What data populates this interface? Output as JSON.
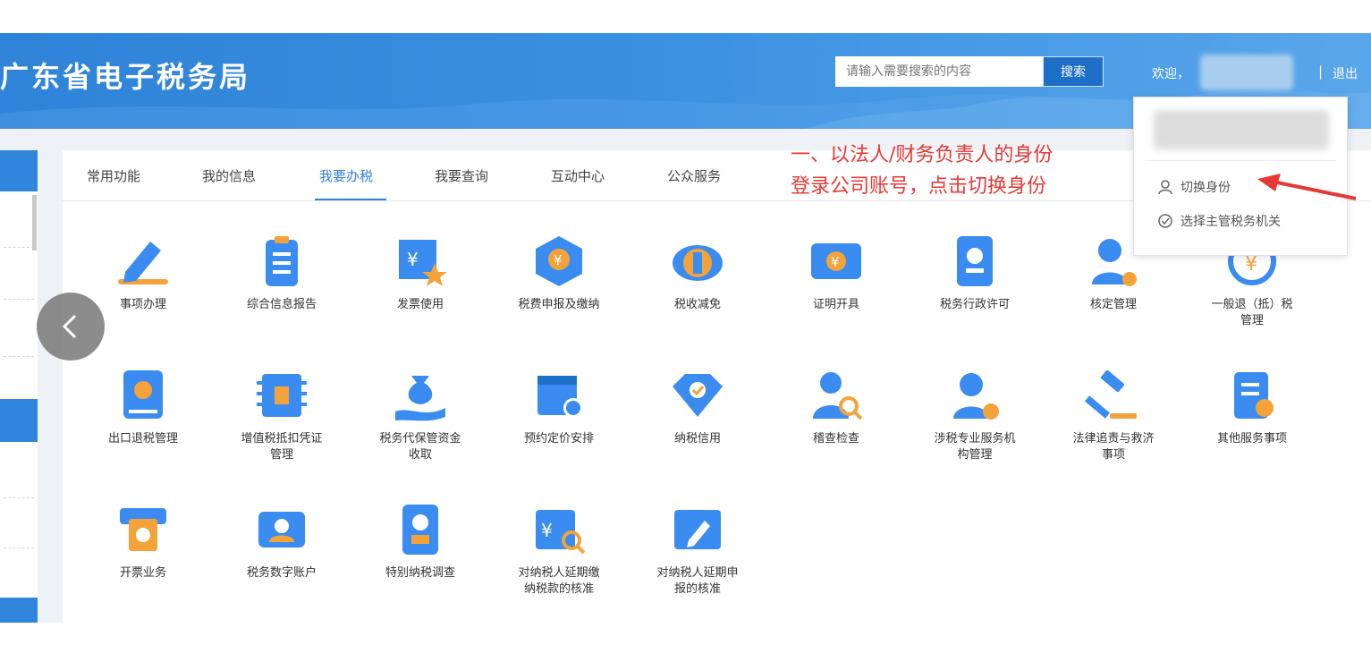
{
  "header": {
    "title": "广东省电子税务局",
    "search_placeholder": "请输入需要搜索的内容",
    "search_button": "搜索",
    "welcome": "欢迎，",
    "separator": "|",
    "logout": "退出"
  },
  "tabs": [
    "常用功能",
    "我的信息",
    "我要办税",
    "我要查询",
    "互动中心",
    "公众服务"
  ],
  "active_tab": "我要办税",
  "annotation": {
    "line1": "一、以法人/财务负责人的身份",
    "line2": "登录公司账号，点击切换身份"
  },
  "dropdown": {
    "items": [
      "切换身份",
      "选择主管税务机关"
    ]
  },
  "services": [
    [
      "事项办理",
      "综合信息报告",
      "发票使用",
      "税费申报及缴纳",
      "税收减免",
      "证明开具",
      "税务行政许可",
      "核定管理",
      "一般退（抵）税\n管理"
    ],
    [
      "出口退税管理",
      "增值税抵扣凭证\n管理",
      "税务代保管资金\n收取",
      "预约定价安排",
      "纳税信用",
      "稽查检查",
      "涉税专业服务机\n构管理",
      "法律追责与救济\n事项",
      "其他服务事项"
    ],
    [
      "开票业务",
      "税务数字账户",
      "特别纳税调查",
      "对纳税人延期缴\n纳税款的核准",
      "对纳税人延期申\n报的核准"
    ]
  ],
  "colors": {
    "header_blue": "#3a8fe0",
    "accent": "#2f80d6",
    "annotation_red": "#e53935",
    "icon_blue": "#3b8cf0",
    "icon_orange": "#f4a33a"
  }
}
